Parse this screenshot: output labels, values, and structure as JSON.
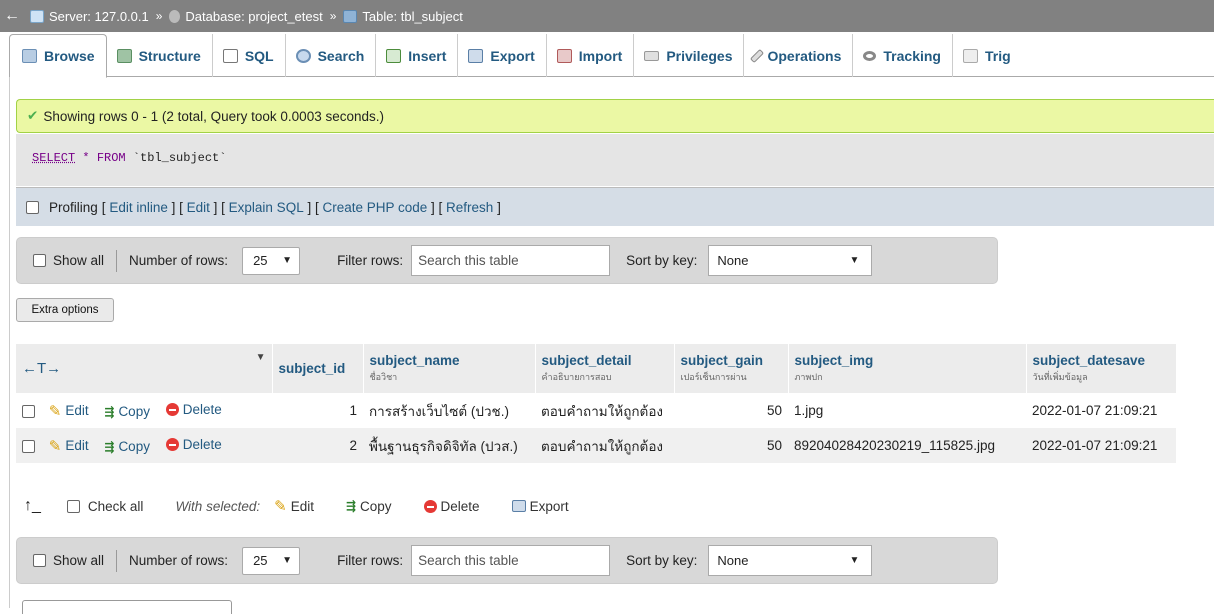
{
  "breadcrumb": {
    "server": "Server: 127.0.0.1",
    "database": "Database: project_etest",
    "table": "Table: tbl_subject",
    "separator": "»"
  },
  "tabs": [
    {
      "label": "Browse",
      "icon": "browse-icon",
      "active": true
    },
    {
      "label": "Structure",
      "icon": "structure-icon"
    },
    {
      "label": "SQL",
      "icon": "sql-icon"
    },
    {
      "label": "Search",
      "icon": "search-icon"
    },
    {
      "label": "Insert",
      "icon": "insert-icon"
    },
    {
      "label": "Export",
      "icon": "export-icon"
    },
    {
      "label": "Import",
      "icon": "import-icon"
    },
    {
      "label": "Privileges",
      "icon": "privileges-icon"
    },
    {
      "label": "Operations",
      "icon": "operations-icon"
    },
    {
      "label": "Tracking",
      "icon": "tracking-icon"
    },
    {
      "label": "Trig",
      "icon": "triggers-icon"
    }
  ],
  "message": {
    "success": "Showing rows 0 - 1 (2 total, Query took 0.0003 seconds.)"
  },
  "query": {
    "select": "SELECT",
    "star": "*",
    "from": "FROM",
    "table": "`tbl_subject`"
  },
  "profiling": {
    "label": "Profiling",
    "links": [
      "Edit inline",
      "Edit",
      "Explain SQL",
      "Create PHP code",
      "Refresh"
    ]
  },
  "nav": {
    "show_all": "Show all",
    "number_of_rows": "Number of rows:",
    "rows_value": "25",
    "filter_rows": "Filter rows:",
    "filter_placeholder": "Search this table",
    "sort_by_key": "Sort by key:",
    "sort_value": "None"
  },
  "extra_options": "Extra options",
  "table": {
    "sort_arrows": "←T→",
    "columns": [
      {
        "name": "subject_id",
        "comment": ""
      },
      {
        "name": "subject_name",
        "comment": "ชื่อวิชา"
      },
      {
        "name": "subject_detail",
        "comment": "คำอธิบายการสอบ"
      },
      {
        "name": "subject_gain",
        "comment": "เปอร์เซ็นการผ่าน"
      },
      {
        "name": "subject_img",
        "comment": "ภาพปก"
      },
      {
        "name": "subject_datesave",
        "comment": "วันที่เพิ่มข้อมูล"
      }
    ],
    "actions": {
      "edit": "Edit",
      "copy": "Copy",
      "delete": "Delete"
    },
    "rows": [
      {
        "subject_id": "1",
        "subject_name": "การสร้างเว็บไซต์ (ปวช.)",
        "subject_detail": "ตอบคำถามให้ถูกต้อง",
        "subject_gain": "50",
        "subject_img": "1.jpg",
        "subject_datesave": "2022-01-07 21:09:21"
      },
      {
        "subject_id": "2",
        "subject_name": "พื้นฐานธุรกิจดิจิทัล (ปวส.)",
        "subject_detail": "ตอบคำถามให้ถูกต้อง",
        "subject_gain": "50",
        "subject_img": "89204028420230219_115825.jpg",
        "subject_datesave": "2022-01-07 21:09:21"
      }
    ]
  },
  "bulk": {
    "check_all": "Check all",
    "with_selected": "With selected:",
    "edit": "Edit",
    "copy": "Copy",
    "delete": "Delete",
    "export": "Export"
  }
}
